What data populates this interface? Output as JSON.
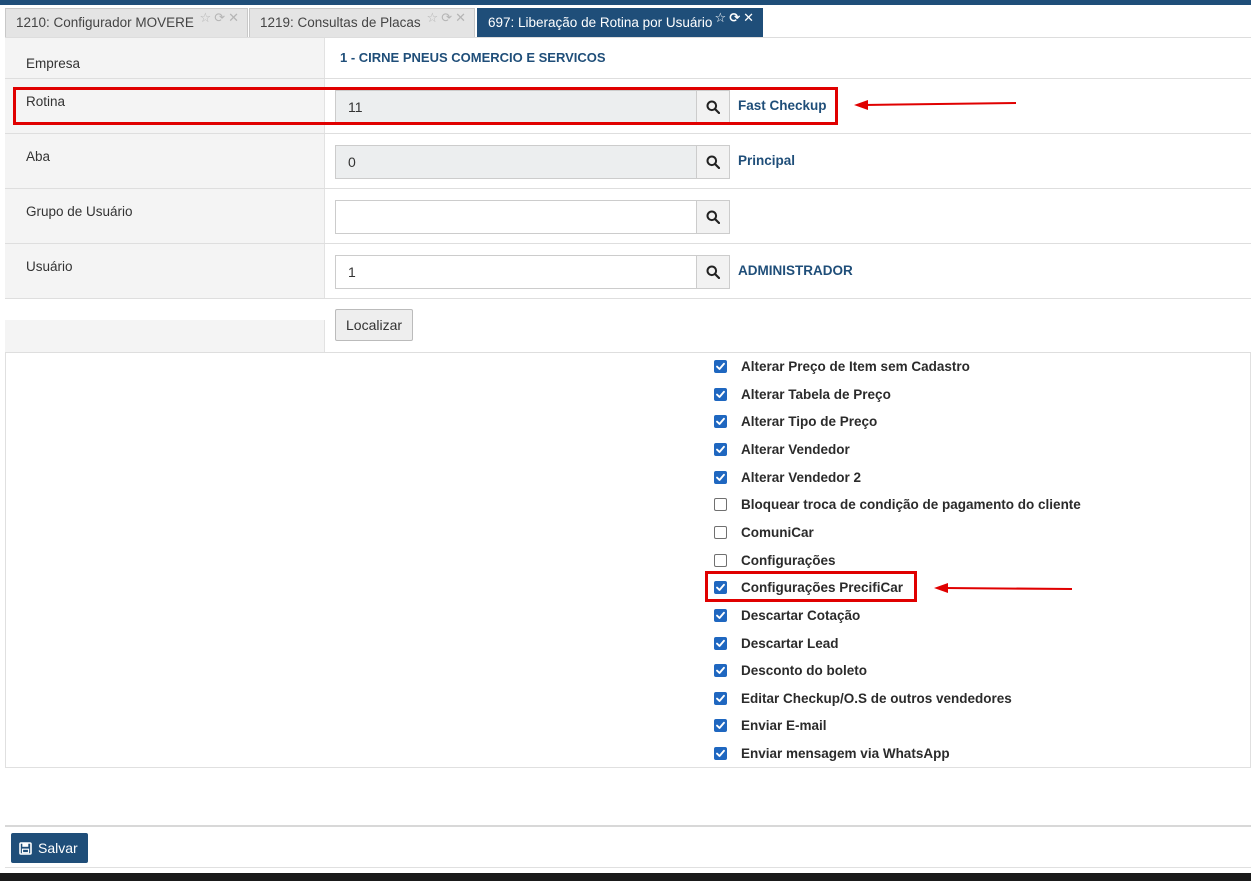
{
  "tabs": [
    {
      "label": "1210: Configurador MOVERE",
      "active": false
    },
    {
      "label": "1219: Consultas de Placas",
      "active": false
    },
    {
      "label": "697: Liberação de Rotina por Usuário",
      "active": true
    }
  ],
  "tab_controls": {
    "favorite": "☆",
    "refresh": "⟳",
    "close": "✕"
  },
  "form": {
    "empresa": {
      "label": "Empresa",
      "value": "1 - CIRNE PNEUS COMERCIO E SERVICOS"
    },
    "rotina": {
      "label": "Rotina",
      "value": "11",
      "lookup": "Fast Checkup"
    },
    "aba": {
      "label": "Aba",
      "value": "0",
      "lookup": "Principal"
    },
    "grupo": {
      "label": "Grupo de Usuário",
      "value": ""
    },
    "usuario": {
      "label": "Usuário",
      "value": "1",
      "lookup": "ADMINISTRADOR"
    },
    "localizar_label": "Localizar"
  },
  "permissions": [
    {
      "label": "Alterar Preço de Item sem Cadastro",
      "checked": true
    },
    {
      "label": "Alterar Tabela de Preço",
      "checked": true
    },
    {
      "label": "Alterar Tipo de Preço",
      "checked": true
    },
    {
      "label": "Alterar Vendedor",
      "checked": true
    },
    {
      "label": "Alterar Vendedor 2",
      "checked": true
    },
    {
      "label": "Bloquear troca de condição de pagamento do cliente",
      "checked": false
    },
    {
      "label": "ComuniCar",
      "checked": false
    },
    {
      "label": "Configurações",
      "checked": false
    },
    {
      "label": "Configurações PrecifiCar",
      "checked": true
    },
    {
      "label": "Descartar Cotação",
      "checked": true
    },
    {
      "label": "Descartar Lead",
      "checked": true
    },
    {
      "label": "Desconto do boleto",
      "checked": true
    },
    {
      "label": "Editar Checkup/O.S de outros vendedores",
      "checked": true
    },
    {
      "label": "Enviar E-mail",
      "checked": true
    },
    {
      "label": "Enviar mensagem via WhatsApp",
      "checked": true
    }
  ],
  "footer": {
    "save_label": "Salvar"
  },
  "colors": {
    "primary": "#1f4e79",
    "annotation": "#e00000",
    "checkbox": "#1f67c0"
  },
  "icons": {
    "search": "search-icon",
    "save": "save-icon",
    "check": "check-icon"
  }
}
